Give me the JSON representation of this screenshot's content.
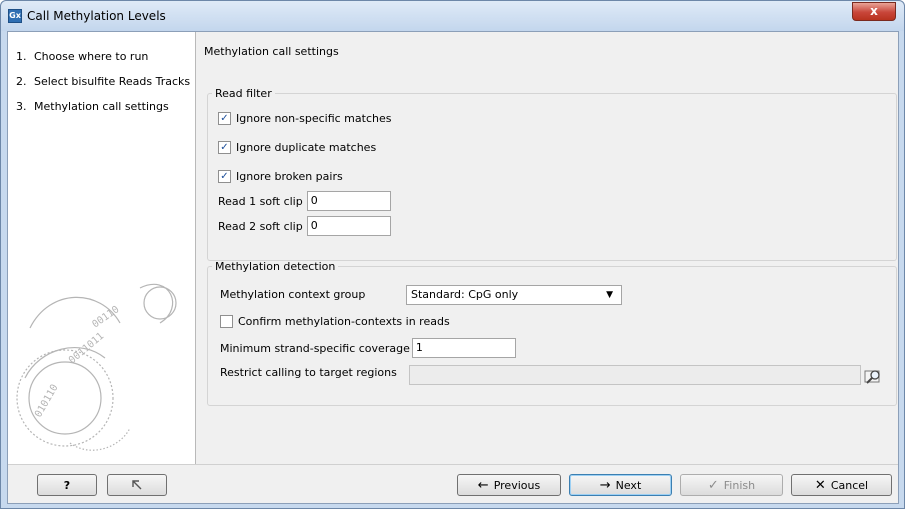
{
  "window": {
    "title": "Call Methylation Levels",
    "app_icon_text": "Gx",
    "close_symbol": "x"
  },
  "steps": [
    {
      "num": "1.",
      "label": "Choose where to run"
    },
    {
      "num": "2.",
      "label": "Select bisulfite Reads Tracks"
    },
    {
      "num": "3.",
      "label": "Methylation call settings"
    }
  ],
  "main": {
    "section_title": "Methylation call settings",
    "read_filter": {
      "legend": "Read filter",
      "ignore_non_specific": {
        "label": "Ignore non-specific matches",
        "checked": true
      },
      "ignore_duplicate": {
        "label": "Ignore duplicate matches",
        "checked": true
      },
      "ignore_broken": {
        "label": "Ignore broken pairs",
        "checked": true
      },
      "read1_soft_clip": {
        "label": "Read 1 soft clip",
        "value": "0"
      },
      "read2_soft_clip": {
        "label": "Read 2 soft clip",
        "value": "0"
      }
    },
    "methylation_detection": {
      "legend": "Methylation detection",
      "context_group": {
        "label": "Methylation context group",
        "value": "Standard: CpG only"
      },
      "confirm_contexts": {
        "label": "Confirm methylation-contexts in reads",
        "checked": false
      },
      "min_coverage": {
        "label": "Minimum strand-specific coverage",
        "value": "1"
      },
      "restrict_regions": {
        "label": "Restrict calling to target regions",
        "value": ""
      }
    }
  },
  "buttons": {
    "help": "?",
    "previous": "Previous",
    "next": "Next",
    "finish": "Finish",
    "cancel": "Cancel"
  },
  "icons": {
    "check": "✓",
    "dropdown_arrow": "▼",
    "previous_arrow": "←",
    "next_arrow": "→",
    "finish_check": "✓",
    "cancel_x": "✕"
  },
  "colors": {
    "titlebar": "#c3d6ed",
    "close": "#c8463a",
    "checkmark": "#1c4e9a",
    "logo": "#b5b5b5"
  }
}
